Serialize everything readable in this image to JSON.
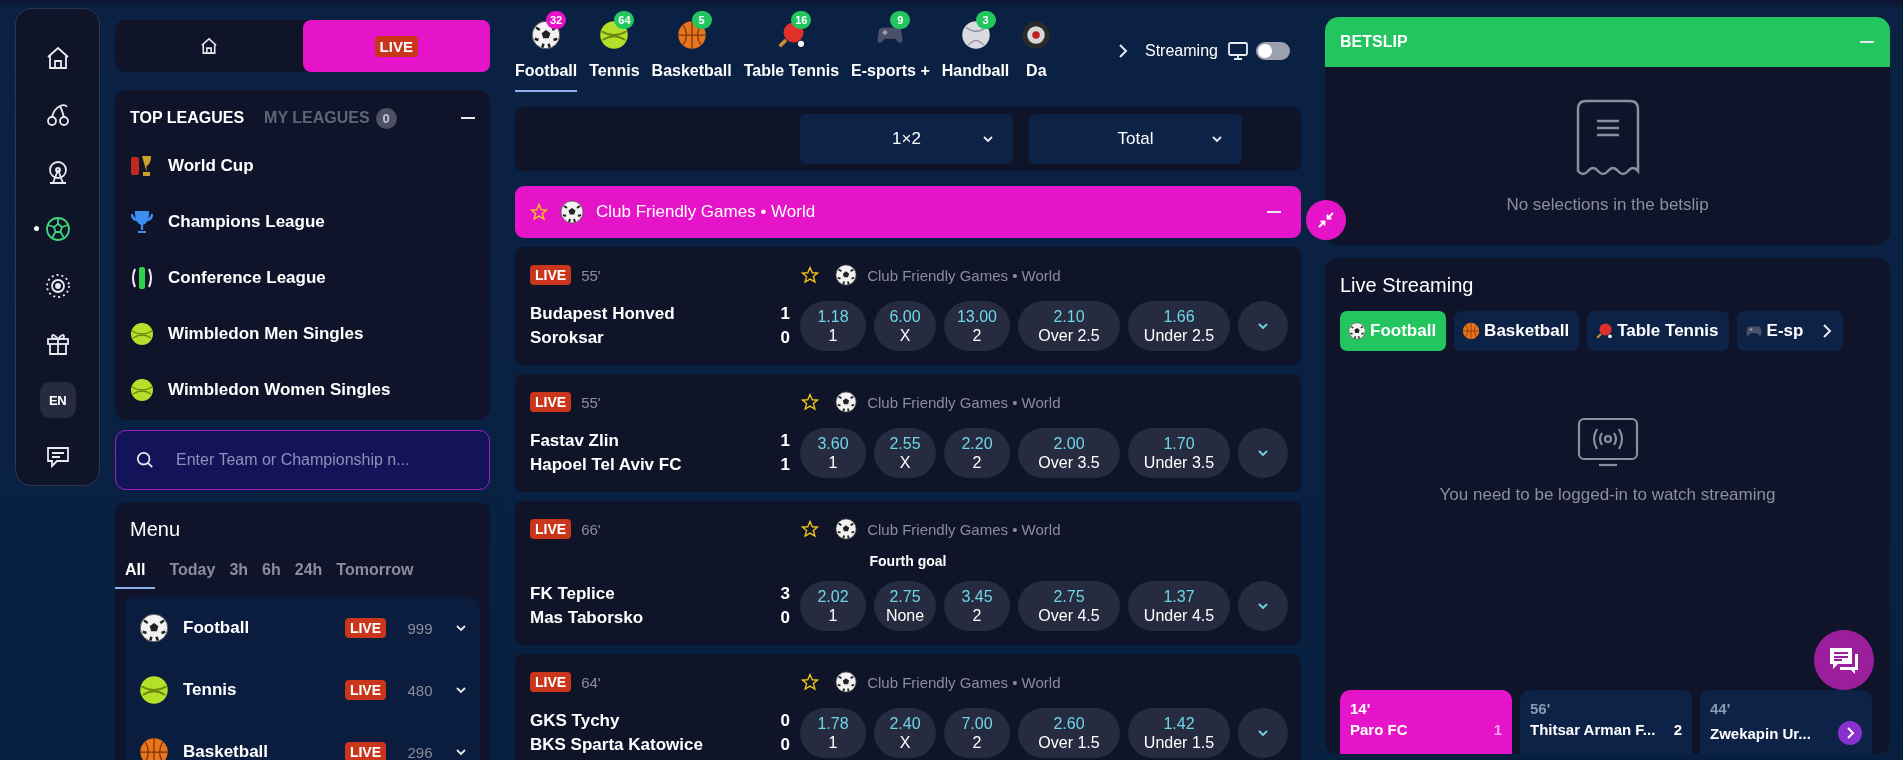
{
  "rail": [
    {
      "kind": "home",
      "selected": false
    },
    {
      "kind": "cherries",
      "selected": false
    },
    {
      "kind": "ferris-wheel",
      "selected": false
    },
    {
      "kind": "football",
      "selected": true
    },
    {
      "kind": "roulette",
      "selected": false
    },
    {
      "kind": "gift",
      "selected": false
    },
    {
      "kind": "language",
      "label": "EN",
      "selected": false
    },
    {
      "kind": "chat",
      "selected": false
    }
  ],
  "top_nav": [
    {
      "kind": "home",
      "selected": false
    },
    {
      "kind": "live",
      "label": "LIVE",
      "selected": true
    }
  ],
  "leagues": {
    "tabs": [
      {
        "label": "TOP LEAGUES",
        "selected": true
      },
      {
        "label": "MY LEAGUES",
        "count": "0",
        "selected": false
      }
    ],
    "items": [
      {
        "kind": "world-cup",
        "name": "World Cup"
      },
      {
        "kind": "champions",
        "name": "Champions League"
      },
      {
        "kind": "conference",
        "name": "Conference League"
      },
      {
        "kind": "tennis",
        "name": "Wimbledon Men Singles"
      },
      {
        "kind": "tennis",
        "name": "Wimbledon Women Singles"
      }
    ]
  },
  "search": {
    "placeholder": "Enter Team or Championship n..."
  },
  "menu": {
    "title": "Menu",
    "filters": [
      {
        "label": "All",
        "selected": true
      },
      {
        "label": "Today",
        "selected": false
      },
      {
        "label": "3h",
        "selected": false
      },
      {
        "label": "6h",
        "selected": false
      },
      {
        "label": "24h",
        "selected": false
      },
      {
        "label": "Tomorrow",
        "selected": false
      }
    ],
    "sports": [
      {
        "kind": "football",
        "name": "Football",
        "badge": "LIVE",
        "count": "999"
      },
      {
        "kind": "tennis",
        "name": "Tennis",
        "badge": "LIVE",
        "count": "480"
      },
      {
        "kind": "basketball",
        "name": "Basketball",
        "badge": "LIVE",
        "count": "296"
      }
    ]
  },
  "sports_tabs": {
    "items": [
      {
        "kind": "football",
        "label": "Football",
        "count": "32",
        "selected": true
      },
      {
        "kind": "tennis",
        "label": "Tennis",
        "count": "64",
        "selected": false
      },
      {
        "kind": "basketball",
        "label": "Basketball",
        "count": "5",
        "selected": false
      },
      {
        "kind": "table-tennis",
        "label": "Table Tennis",
        "count": "16",
        "selected": false
      },
      {
        "kind": "esports",
        "label": "E-sports +",
        "count": "9",
        "selected": false
      },
      {
        "kind": "handball",
        "label": "Handball",
        "count": "3",
        "selected": false
      },
      {
        "kind": "darts",
        "label": "Da",
        "selected": false
      }
    ],
    "streaming": {
      "label": "Streaming",
      "on": false
    }
  },
  "markets": [
    {
      "label": "1×2"
    },
    {
      "label": "Total"
    }
  ],
  "league_header": {
    "title": "Club Friendly Games • World",
    "favorite": false
  },
  "matches": [
    {
      "status": "LIVE",
      "minute": "55'",
      "favorite": false,
      "league": "Club Friendly Games • World",
      "teams": [
        {
          "name": "Budapest Honved",
          "score": "1"
        },
        {
          "name": "Soroksar",
          "score": "0"
        }
      ],
      "odds": [
        {
          "value": "1.18",
          "label": "1"
        },
        {
          "value": "6.00",
          "label": "X"
        },
        {
          "value": "13.00",
          "label": "2"
        },
        {
          "value": "2.10",
          "label": "Over 2.5"
        },
        {
          "value": "1.66",
          "label": "Under 2.5"
        }
      ]
    },
    {
      "status": "LIVE",
      "minute": "55'",
      "favorite": false,
      "league": "Club Friendly Games • World",
      "teams": [
        {
          "name": "Fastav Zlin",
          "score": "1"
        },
        {
          "name": "Hapoel Tel Aviv FC",
          "score": "1"
        }
      ],
      "odds": [
        {
          "value": "3.60",
          "label": "1"
        },
        {
          "value": "2.55",
          "label": "X"
        },
        {
          "value": "2.20",
          "label": "2"
        },
        {
          "value": "2.00",
          "label": "Over 3.5"
        },
        {
          "value": "1.70",
          "label": "Under 3.5"
        }
      ]
    },
    {
      "status": "LIVE",
      "minute": "66'",
      "favorite": false,
      "league": "Club Friendly Games • World",
      "note": "Fourth goal",
      "teams": [
        {
          "name": "FK Teplice",
          "score": "3"
        },
        {
          "name": "Mas Taborsko",
          "score": "0"
        }
      ],
      "odds": [
        {
          "value": "2.02",
          "label": "1"
        },
        {
          "value": "2.75",
          "label": "None"
        },
        {
          "value": "3.45",
          "label": "2"
        },
        {
          "value": "2.75",
          "label": "Over 4.5"
        },
        {
          "value": "1.37",
          "label": "Under 4.5"
        }
      ]
    },
    {
      "status": "LIVE",
      "minute": "64'",
      "favorite": false,
      "league": "Club Friendly Games • World",
      "teams": [
        {
          "name": "GKS Tychy",
          "score": "0"
        },
        {
          "name": "BKS Sparta Katowice",
          "score": "0"
        }
      ],
      "odds": [
        {
          "value": "1.78",
          "label": "1"
        },
        {
          "value": "2.40",
          "label": "X"
        },
        {
          "value": "7.00",
          "label": "2"
        },
        {
          "value": "2.60",
          "label": "Over 1.5"
        },
        {
          "value": "1.42",
          "label": "Under 1.5"
        }
      ]
    }
  ],
  "betslip": {
    "title": "BETSLIP",
    "empty_text": "No selections in the betslip"
  },
  "live_streaming": {
    "title": "Live Streaming",
    "tabs": [
      {
        "kind": "football",
        "label": "Football",
        "selected": true
      },
      {
        "kind": "basketball",
        "label": "Basketball",
        "selected": false
      },
      {
        "kind": "table-tennis",
        "label": "Table Tennis",
        "selected": false
      },
      {
        "kind": "esports",
        "label": "E-sp",
        "selected": false
      }
    ],
    "message": "You need to be logged-in to watch streaming",
    "events": [
      {
        "minute": "14'",
        "team": "Paro FC",
        "score": "1",
        "selected": true
      },
      {
        "minute": "56'",
        "team": "Thitsar Arman F...",
        "score": "2",
        "selected": false
      },
      {
        "minute": "44'",
        "team": "Zwekapin Ur...",
        "selected": false
      }
    ]
  }
}
